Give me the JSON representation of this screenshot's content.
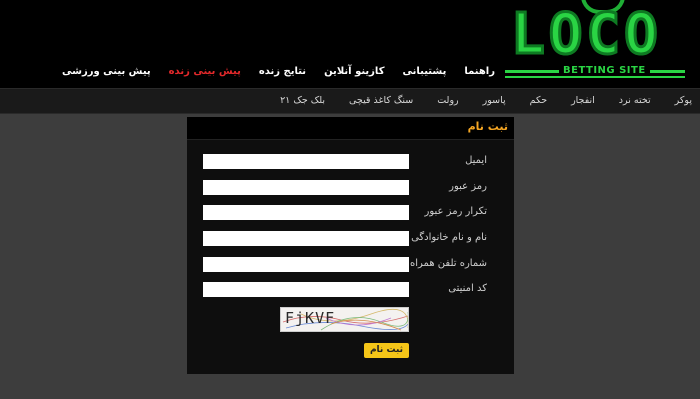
{
  "logo": {
    "text": "LOCO",
    "subtitle": "BETTING SITE"
  },
  "top_nav": {
    "items": [
      {
        "label": "پیش بینی ورزشی",
        "active": false
      },
      {
        "label": "پیش بینی زنده",
        "active": true
      },
      {
        "label": "نتایج زنده",
        "active": false
      },
      {
        "label": "کازینو آنلاین",
        "active": false
      },
      {
        "label": "پشتیبانی",
        "active": false
      },
      {
        "label": "راهنما",
        "active": false
      }
    ]
  },
  "sub_nav": {
    "items": [
      "پوکر",
      "تخته نرد",
      "انفجار",
      "حکم",
      "پاسور",
      "رولت",
      "سنگ کاغذ قیچی",
      "بلک جک ۲۱"
    ]
  },
  "form": {
    "title": "ثبت نام",
    "fields": [
      {
        "label": "ایمیل",
        "value": ""
      },
      {
        "label": "رمز عبور",
        "value": ""
      },
      {
        "label": "تکرار رمز عبور",
        "value": ""
      },
      {
        "label": "نام و نام خانوادگی",
        "value": ""
      },
      {
        "label": "شماره تلفن همراه",
        "value": ""
      },
      {
        "label": "کد امنیتی",
        "value": ""
      }
    ],
    "captcha_text": "FjKVF",
    "submit_label": "ثبت نام"
  },
  "colors": {
    "accent": "#f5a623",
    "active_nav": "#e3292b",
    "logo_green": "#2ad444",
    "button": "#f5c518"
  }
}
